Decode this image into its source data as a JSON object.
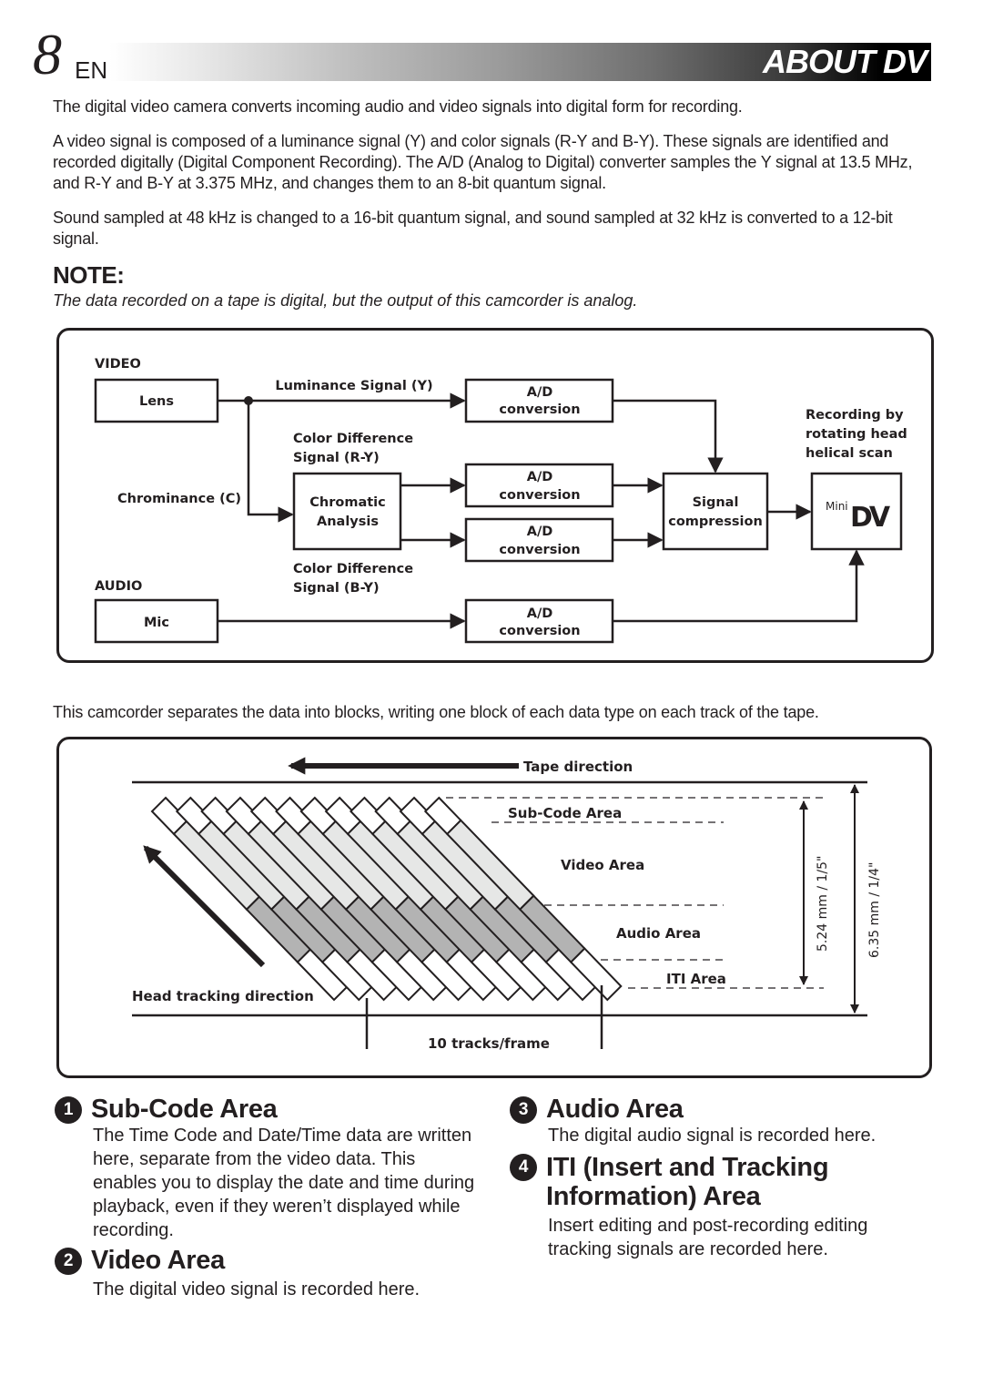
{
  "header": {
    "page_number": "8",
    "language": "EN",
    "title": "ABOUT DV"
  },
  "intro": {
    "paragraphs": [
      "The digital video camera converts incoming audio and video signals into digital form for recording.",
      "A video signal is composed of a luminance signal (Y) and color signals (R-Y and B-Y). These signals are identified and recorded digitally (Digital Component Recording). The A/D (Analog to Digital) converter samples the Y signal at 13.5 MHz, and R-Y and B-Y at 3.375 MHz, and changes them to an 8-bit quantum signal.",
      "Sound sampled at 48 kHz is changed to a 16-bit quantum signal, and sound sampled at 32 kHz is converted to a 12-bit signal."
    ]
  },
  "note": {
    "heading": "NOTE:",
    "text": "The data recorded on a tape is digital, but the output of this camcorder is analog."
  },
  "signal_diagram": {
    "video_label": "VIDEO",
    "audio_label": "AUDIO",
    "lens": "Lens",
    "mic": "Mic",
    "luminance_label": "Luminance Signal (Y)",
    "chrominance_label": "Chrominance (C)",
    "color_diff_ry": [
      "Color Difference",
      "Signal (R-Y)"
    ],
    "color_diff_by": [
      "Color Difference",
      "Signal (B-Y)"
    ],
    "chromatic_analysis": [
      "Chromatic",
      "Analysis"
    ],
    "ad_conversion": [
      "A/D",
      "conversion"
    ],
    "signal_compression": [
      "Signal",
      "compression"
    ],
    "recording_note": [
      "Recording by",
      "rotating head",
      "helical scan"
    ],
    "minidv_logo": {
      "small": "Mini",
      "big": "DV"
    }
  },
  "track_intro": "This camcorder separates the data into blocks, writing one block of each data type on each track of the tape.",
  "track_diagram": {
    "tape_direction": "Tape direction",
    "head_tracking": "Head tracking direction",
    "tracks_per_frame": "10 tracks/frame",
    "track_count": 12,
    "areas": [
      "Sub-Code Area",
      "Video Area",
      "Audio Area",
      "ITI Area"
    ],
    "track_width_label": "5.24 mm / 1/5\"",
    "tape_width_label": "6.35 mm / 1/4\"",
    "colors": {
      "subcode": "#ffffff",
      "video": "#e6e7e6",
      "audio": "#b3b3b3",
      "iti": "#ffffff"
    }
  },
  "sections": [
    {
      "num": "1",
      "title": "Sub-Code Area",
      "body": "The Time Code and Date/Time data are written here, separate from the video data. This enables you to display the date and time during playback, even if they weren’t displayed while recording."
    },
    {
      "num": "2",
      "title": "Video Area",
      "body": "The digital video signal is recorded here."
    },
    {
      "num": "3",
      "title": "Audio Area",
      "body": "The digital audio signal is recorded here."
    },
    {
      "num": "4",
      "title": "ITI (Insert and Tracking Information) Area",
      "body": "Insert editing and post-recording editing tracking signals are recorded here."
    }
  ]
}
